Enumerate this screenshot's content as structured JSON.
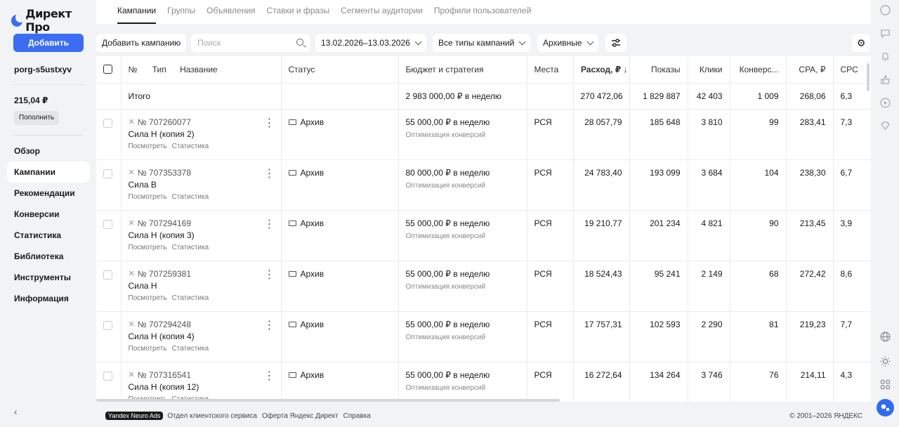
{
  "sidebar": {
    "logo_text": "Директ Про",
    "add_button": "Добавить",
    "login": "porg-s5ustxyv",
    "balance": "215,04 ₽",
    "topup": "Пополнить",
    "nav": [
      {
        "label": "Обзор",
        "active": false
      },
      {
        "label": "Кампании",
        "active": true
      },
      {
        "label": "Рекомендации",
        "active": false
      },
      {
        "label": "Конверсии",
        "active": false
      },
      {
        "label": "Статистика",
        "active": false
      },
      {
        "label": "Библиотека",
        "active": false
      },
      {
        "label": "Инструменты",
        "active": false
      },
      {
        "label": "Информация",
        "active": false
      }
    ]
  },
  "tabs": [
    "Кампании",
    "Группы",
    "Объявления",
    "Ставки и фразы",
    "Сегменты аудитории",
    "Профили пользователей"
  ],
  "toolbar": {
    "add_campaign": "Добавить кампанию",
    "search_placeholder": "Поиск",
    "date_range": "13.02.2026–13.03.2026",
    "types": "Все типы кампаний",
    "archive": "Архивные"
  },
  "table": {
    "headers": {
      "num": "№",
      "type": "Тип",
      "name": "Название",
      "status": "Статус",
      "budget": "Бюджет и стратегия",
      "places": "Места",
      "spend": "Расход, ₽",
      "impressions": "Показы",
      "clicks": "Клики",
      "conversions": "Конверс...",
      "cpa": "CPA, ₽",
      "cpc": "CPC"
    },
    "total": {
      "label": "Итого",
      "budget": "2 983 000,00 ₽ в неделю",
      "spend": "270 472,06",
      "impressions": "1 829 887",
      "clicks": "42 403",
      "conversions": "1 009",
      "cpa": "268,06",
      "cpc": "6,3"
    },
    "row_links": {
      "view": "Посмотреть",
      "stats": "Статистика"
    },
    "rows": [
      {
        "id": "№ 707260077",
        "name": "Сила Н (копия 2)",
        "status": "Архив",
        "budget": "55 000,00 ₽ в неделю",
        "strategy": "Оптимизация конверсий",
        "places": "РСЯ",
        "spend": "28 057,79",
        "impressions": "185 648",
        "clicks": "3 810",
        "conversions": "99",
        "cpa": "283,41",
        "cpc": "7,3"
      },
      {
        "id": "№ 707353378",
        "name": "Сила В",
        "status": "Архив",
        "budget": "80 000,00 ₽ в неделю",
        "strategy": "Оптимизация конверсий",
        "places": "РСЯ",
        "spend": "24 783,40",
        "impressions": "193 099",
        "clicks": "3 684",
        "conversions": "104",
        "cpa": "238,30",
        "cpc": "6,7"
      },
      {
        "id": "№ 707294169",
        "name": "Сила Н (копия 3)",
        "status": "Архив",
        "budget": "55 000,00 ₽ в неделю",
        "strategy": "Оптимизация конверсий",
        "places": "РСЯ",
        "spend": "19 210,77",
        "impressions": "201 234",
        "clicks": "4 821",
        "conversions": "90",
        "cpa": "213,45",
        "cpc": "3,9"
      },
      {
        "id": "№ 707259381",
        "name": "Сила Н",
        "status": "Архив",
        "budget": "55 000,00 ₽ в неделю",
        "strategy": "Оптимизация конверсий",
        "places": "РСЯ",
        "spend": "18 524,43",
        "impressions": "95 241",
        "clicks": "2 149",
        "conversions": "68",
        "cpa": "272,42",
        "cpc": "8,6"
      },
      {
        "id": "№ 707294248",
        "name": "Сила Н (копия 4)",
        "status": "Архив",
        "budget": "55 000,00 ₽ в неделю",
        "strategy": "Оптимизация конверсий",
        "places": "РСЯ",
        "spend": "17 757,31",
        "impressions": "102 593",
        "clicks": "2 290",
        "conversions": "81",
        "cpa": "219,23",
        "cpc": "7,7"
      },
      {
        "id": "№ 707316541",
        "name": "Сила Н (копия 12)",
        "status": "Архив",
        "budget": "55 000,00 ₽ в неделю",
        "strategy": "Оптимизация конверсий",
        "places": "РСЯ",
        "spend": "16 272,64",
        "impressions": "134 264",
        "clicks": "3 746",
        "conversions": "76",
        "cpa": "214,11",
        "cpc": "4,3"
      }
    ]
  },
  "footer": {
    "badge": "Yandex Neuro Ads",
    "links": [
      "Отдел клиентского сервиса",
      "Оферта Яндекс Директ",
      "Справка"
    ],
    "copyright": "© 2001–2026 ЯНДЕКС"
  },
  "rail_icons": [
    "notifications-icon",
    "chat-icon",
    "bell-icon",
    "like-icon",
    "play-icon",
    "diamond-icon",
    "globe-icon",
    "brightness-icon",
    "apps-icon",
    "assistant-icon"
  ]
}
